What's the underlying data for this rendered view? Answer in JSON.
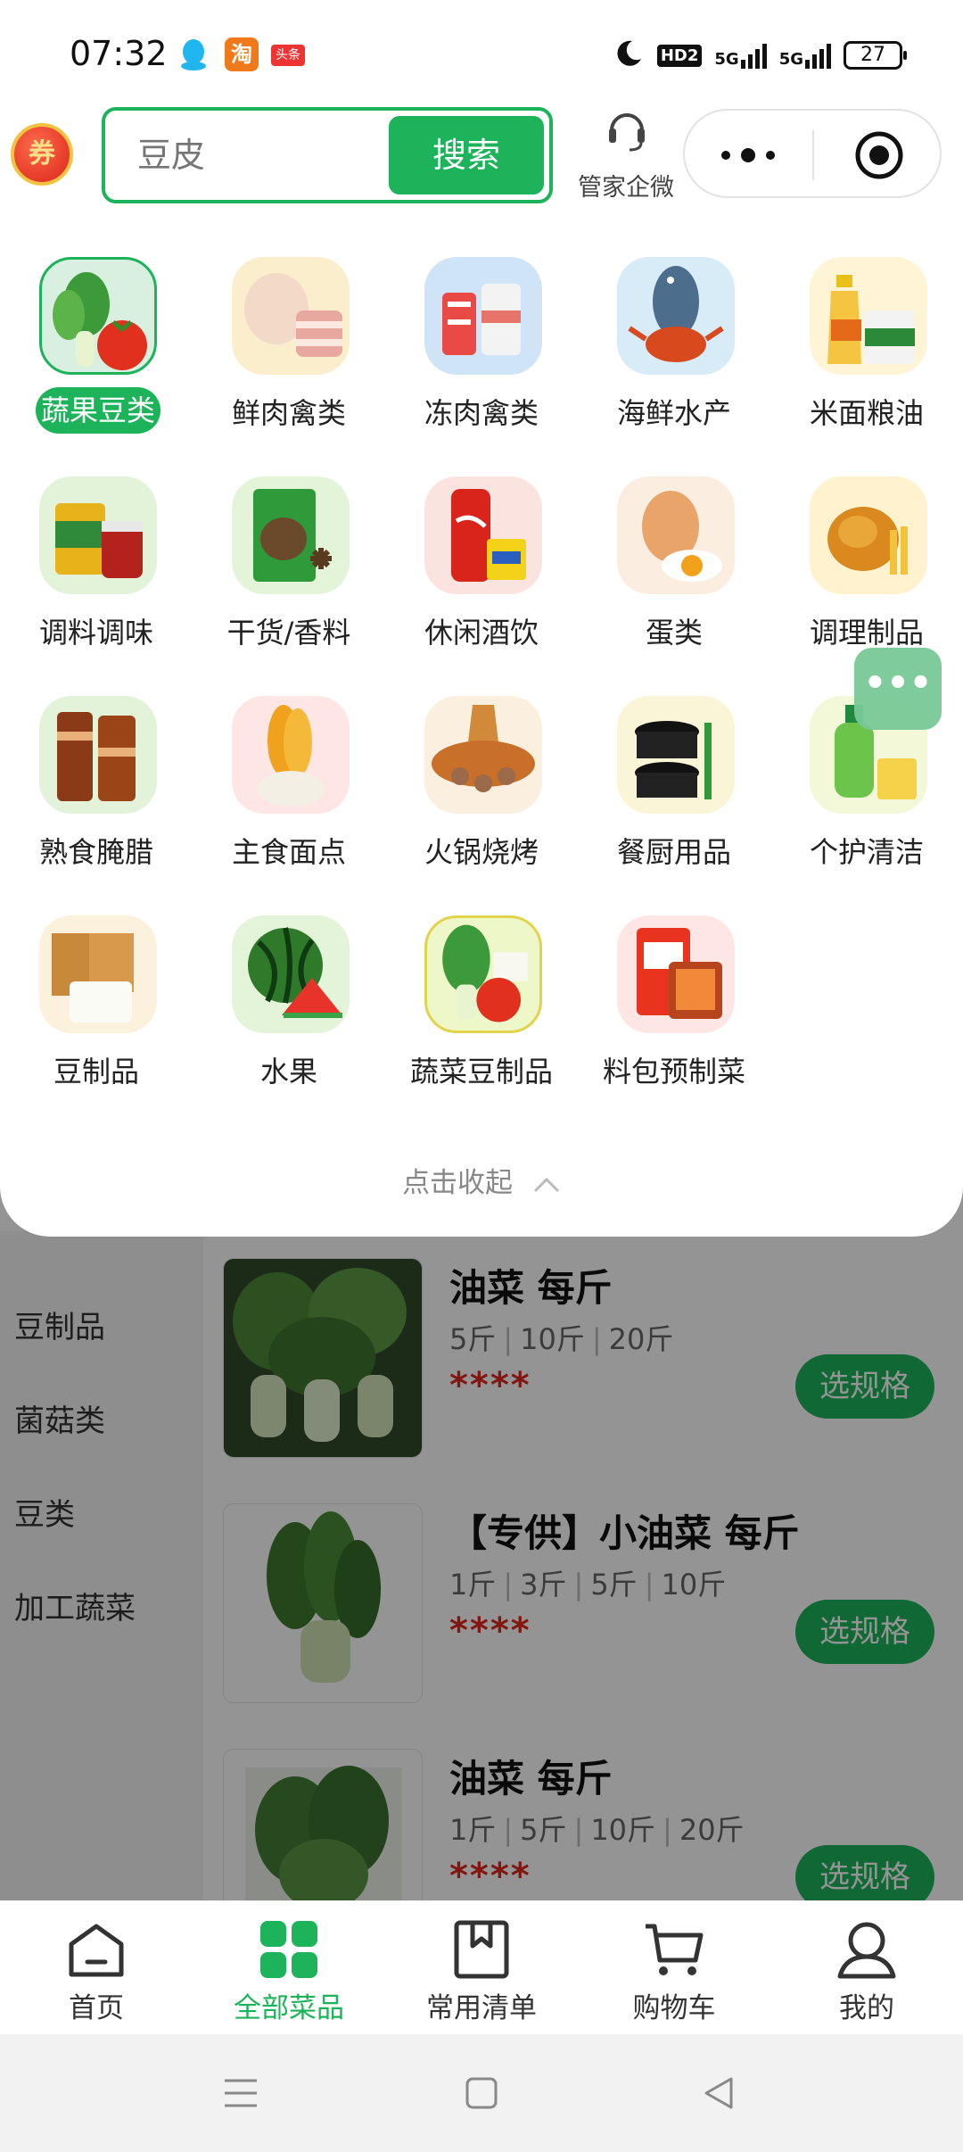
{
  "status_bar": {
    "time": "07:32",
    "hd_label": "HD2",
    "net1": "5G",
    "net2": "5G",
    "battery": "27"
  },
  "header": {
    "coupon_label": "券",
    "search_placeholder": "豆皮",
    "search_button": "搜索",
    "service_label": "管家企微",
    "capsule_more": "•••"
  },
  "categories": [
    {
      "label": "蔬果豆类",
      "active": true
    },
    {
      "label": "鲜肉禽类"
    },
    {
      "label": "冻肉禽类"
    },
    {
      "label": "海鲜水产"
    },
    {
      "label": "米面粮油"
    },
    {
      "label": "调料调味"
    },
    {
      "label": "干货/香料"
    },
    {
      "label": "休闲酒饮"
    },
    {
      "label": "蛋类"
    },
    {
      "label": "调理制品"
    },
    {
      "label": "熟食腌腊"
    },
    {
      "label": "主食面点"
    },
    {
      "label": "火锅烧烤"
    },
    {
      "label": "餐厨用品"
    },
    {
      "label": "个护清洁"
    },
    {
      "label": "豆制品"
    },
    {
      "label": "水果"
    },
    {
      "label": "蔬菜豆制品"
    },
    {
      "label": "料包预制菜"
    }
  ],
  "collapse_label": "点击收起",
  "float_more": "•••",
  "left_categories": [
    "豆制品",
    "菌菇类",
    "豆类",
    "加工蔬菜"
  ],
  "products": [
    {
      "title": "油菜 每斤",
      "specs": [
        "5斤",
        "10斤",
        "20斤"
      ],
      "price": "****",
      "button": "选规格"
    },
    {
      "title": "【专供】小油菜 每斤",
      "specs": [
        "1斤",
        "3斤",
        "5斤",
        "10斤"
      ],
      "price": "****",
      "button": "选规格"
    },
    {
      "title": "油菜 每斤",
      "specs": [
        "1斤",
        "5斤",
        "10斤",
        "20斤"
      ],
      "price": "****",
      "button": "选规格"
    }
  ],
  "tabbar": [
    {
      "label": "首页"
    },
    {
      "label": "全部菜品",
      "active": true
    },
    {
      "label": "常用清单"
    },
    {
      "label": "购物车"
    },
    {
      "label": "我的"
    }
  ],
  "colors": {
    "accent": "#1cb35a",
    "price": "#e0261e"
  }
}
